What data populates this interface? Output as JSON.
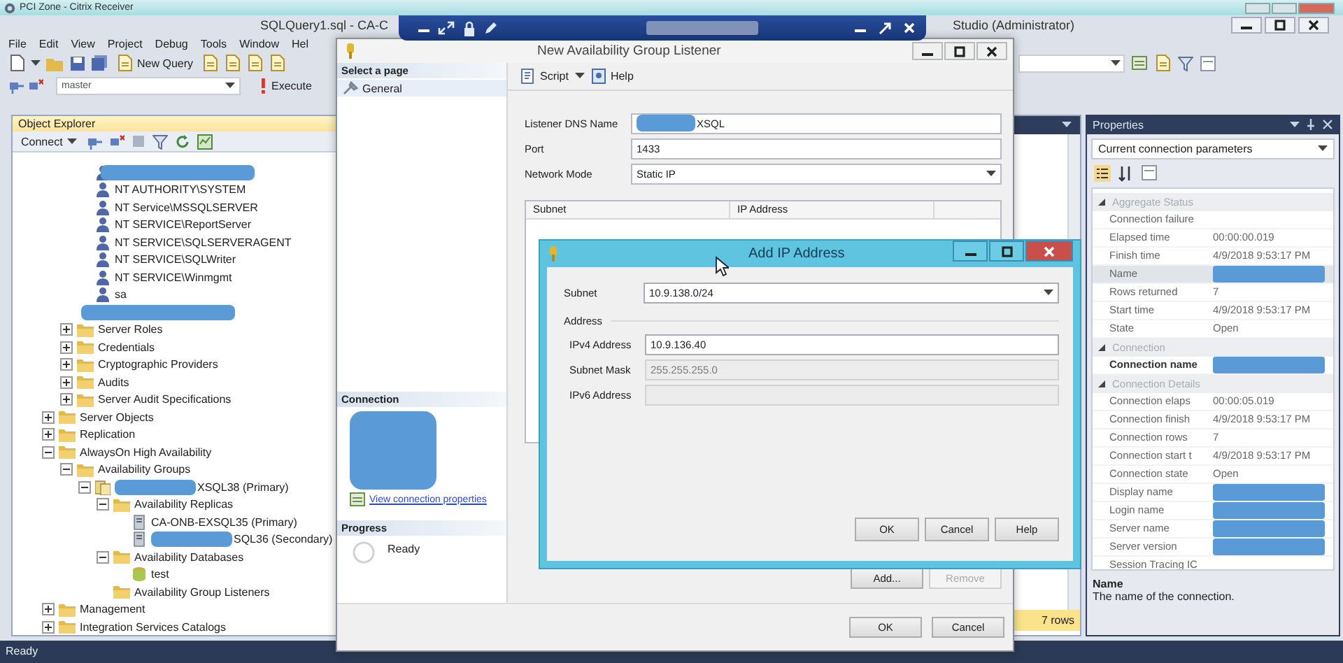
{
  "remote_session": {
    "title": "PCI Zone - Citrix Receiver"
  },
  "app": {
    "title_left": "SQLQuery1.sql - CA-C",
    "title_right": "Studio (Administrator)",
    "menu": [
      "File",
      "Edit",
      "View",
      "Project",
      "Debug",
      "Tools",
      "Window",
      "Hel"
    ],
    "new_query": "New Query",
    "database": "master",
    "execute": "Execute",
    "status": "Ready"
  },
  "object_explorer": {
    "title": "Object Explorer",
    "connect": "Connect",
    "tree": [
      {
        "children": [
          {
            "children": [
              {
                "kind": "login",
                "redacted": true
              },
              {
                "kind": "login",
                "label": "NT AUTHORITY\\SYSTEM"
              },
              {
                "kind": "login",
                "label": "NT Service\\MSSQLSERVER"
              },
              {
                "kind": "login",
                "label": "NT SERVICE\\ReportServer"
              },
              {
                "kind": "login",
                "label": "NT SERVICE\\SQLSERVERAGENT"
              },
              {
                "kind": "login",
                "label": "NT SERVICE\\SQLWriter"
              },
              {
                "kind": "login",
                "label": "NT SERVICE\\Winmgmt"
              },
              {
                "kind": "login",
                "label": "sa"
              },
              {
                "redacted": true
              }
            ]
          },
          {
            "kind": "folder",
            "label": "Server Roles",
            "expanded": false
          },
          {
            "kind": "folder",
            "label": "Credentials",
            "expanded": false
          },
          {
            "kind": "folder",
            "label": "Cryptographic Providers",
            "expanded": false
          },
          {
            "kind": "folder",
            "label": "Audits",
            "expanded": false
          },
          {
            "kind": "folder",
            "label": "Server Audit Specifications",
            "expanded": false
          }
        ]
      },
      {
        "kind": "folder",
        "label": "Server Objects",
        "expanded": false
      },
      {
        "kind": "folder",
        "label": "Replication",
        "expanded": false
      },
      {
        "kind": "folder",
        "label": "AlwaysOn High Availability",
        "expanded": true,
        "children": [
          {
            "kind": "folder",
            "label": "Availability Groups",
            "expanded": true,
            "children": [
              {
                "kind": "group",
                "label": "XSQL38 (Primary)",
                "redacted": true,
                "expanded": true,
                "children": [
                  {
                    "kind": "folder",
                    "label": "Availability Replicas",
                    "expanded": true,
                    "children": [
                      {
                        "kind": "server",
                        "label": "CA-ONB-EXSQL35 (Primary)"
                      },
                      {
                        "kind": "server",
                        "label": "SQL36 (Secondary)",
                        "redacted": true
                      }
                    ]
                  },
                  {
                    "kind": "folder",
                    "label": "Availability Databases",
                    "expanded": true,
                    "children": [
                      {
                        "kind": "database",
                        "label": "test"
                      }
                    ]
                  },
                  {
                    "kind": "folder",
                    "label": "Availability Group Listeners"
                  }
                ]
              }
            ]
          }
        ]
      },
      {
        "kind": "folder",
        "label": "Management",
        "expanded": false
      },
      {
        "kind": "folder",
        "label": "Integration Services Catalogs",
        "expanded": false
      }
    ]
  },
  "results": {
    "row_count": "7 rows"
  },
  "properties": {
    "title": "Properties",
    "object": "Current connection parameters",
    "grid": [
      {
        "label": "Aggregate Status",
        "expanded": true,
        "children": [
          {
            "label": "Connection failure",
            "selected": false,
            "bold": false
          },
          {
            "label": "Elapsed time",
            "value": "00:00:00.019",
            "selected": false,
            "bold": false
          },
          {
            "label": "Finish time",
            "value": "4/9/2018 9:53:17 PM",
            "selected": false,
            "bold": false
          },
          {
            "label": "Name",
            "redacted": true,
            "selected": true,
            "bold": false
          },
          {
            "label": "Rows returned",
            "value": "7",
            "selected": false,
            "bold": false
          },
          {
            "label": "Start time",
            "value": "4/9/2018 9:53:17 PM",
            "selected": false,
            "bold": false
          },
          {
            "label": "State",
            "value": "Open",
            "selected": false,
            "bold": false
          }
        ]
      },
      {
        "label": "Connection",
        "expanded": true,
        "children": [
          {
            "label": "Connection name",
            "redacted": true,
            "selected": false,
            "bold": true
          }
        ]
      },
      {
        "label": "Connection Details",
        "expanded": true,
        "children": [
          {
            "label": "Connection elaps",
            "value": "00:00:05.019",
            "selected": false,
            "bold": false
          },
          {
            "label": "Connection finish",
            "value": "4/9/2018 9:53:17 PM",
            "selected": false,
            "bold": false
          },
          {
            "label": "Connection rows",
            "value": "7",
            "selected": false,
            "bold": false
          },
          {
            "label": "Connection start t",
            "value": "4/9/2018 9:53:17 PM",
            "selected": false,
            "bold": false
          },
          {
            "label": "Connection state",
            "value": "Open",
            "selected": false,
            "bold": false
          },
          {
            "label": "Display name",
            "redacted": true,
            "selected": false,
            "bold": false
          },
          {
            "label": "Login name",
            "redacted": true,
            "selected": false,
            "bold": false
          },
          {
            "label": "Server name",
            "redacted": true,
            "selected": false,
            "bold": false
          },
          {
            "label": "Server version",
            "redacted": true,
            "selected": false,
            "bold": false
          },
          {
            "label": "Session Tracing IC",
            "selected": false,
            "bold": false
          }
        ]
      }
    ],
    "description_title": "Name",
    "description": "The name of the connection."
  },
  "listener_dialog": {
    "title": "New Availability Group Listener",
    "select_page": "Select a page",
    "pages": [
      {
        "label": "General",
        "selected": true
      }
    ],
    "script": "Script",
    "help": "Help",
    "fields": [
      {
        "kind": "text",
        "label": "Listener DNS Name",
        "value": "XSQL",
        "redacted": true
      },
      {
        "kind": "text",
        "label": "Port",
        "value": "1433"
      },
      {
        "kind": "dropdown",
        "label": "Network Mode",
        "value": "Static IP"
      }
    ],
    "grid_columns": [
      "Subnet",
      "IP Address"
    ],
    "grid_buttons": [
      {
        "label": "Add...",
        "disabled": false
      },
      {
        "label": "Remove",
        "disabled": true
      }
    ],
    "connection_heading": "Connection",
    "connection_redacted": true,
    "connection_link": "View connection properties",
    "progress_heading": "Progress",
    "progress_status": "Ready",
    "footer_buttons": [
      "OK",
      "Cancel"
    ]
  },
  "add_ip_dialog": {
    "title": "Add IP Address",
    "subnet_label": "Subnet",
    "subnet": "10.9.138.0/24",
    "group_label": "Address",
    "fields": [
      {
        "label": "IPv4 Address",
        "value": "10.9.136.40",
        "disabled": false
      },
      {
        "label": "Subnet Mask",
        "value": "255.255.255.0",
        "disabled": true
      },
      {
        "label": "IPv6 Address",
        "disabled": true
      }
    ],
    "buttons": [
      "OK",
      "Cancel",
      "Help"
    ]
  }
}
